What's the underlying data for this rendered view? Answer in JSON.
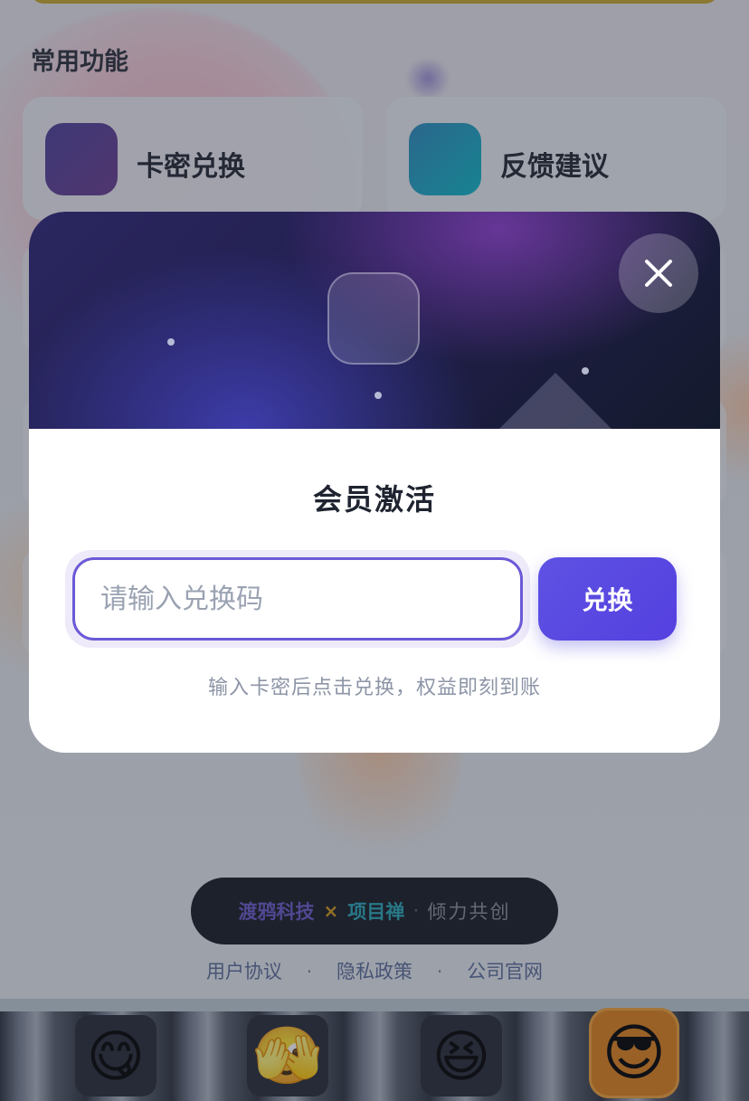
{
  "background": {
    "section_title": "常用功能",
    "cards": [
      {
        "label": "卡密兑换",
        "icon": "card-key-icon"
      },
      {
        "label": "反馈建议",
        "icon": "feedback-icon"
      }
    ],
    "footer": {
      "brand_1": "渡鸦科技",
      "times": "×",
      "brand_2": "项目禅",
      "dot": "·",
      "slogan": "倾力共创"
    },
    "links": {
      "user_agreement": "用户协议",
      "privacy_policy": "隐私政策",
      "official_site": "公司官网",
      "separator": "·"
    },
    "emoji_bar": {
      "items": [
        {
          "emoji": "😋",
          "name": "yum-emoji"
        },
        {
          "emoji": "🫣",
          "name": "peek-emoji"
        },
        {
          "emoji": "😆",
          "name": "laugh-emoji"
        },
        {
          "emoji": "😎",
          "name": "cool-emoji",
          "selected": true
        }
      ]
    }
  },
  "modal": {
    "title": "会员激活",
    "input": {
      "placeholder": "请输入兑换码",
      "value": ""
    },
    "redeem_button": "兑换",
    "hint": "输入卡密后点击兑换，权益即刻到账",
    "close_icon": "close-icon"
  },
  "colors": {
    "accent": "#5e52e3",
    "input_border": "#6b5ad7",
    "hero_dark": "#221f4f"
  }
}
